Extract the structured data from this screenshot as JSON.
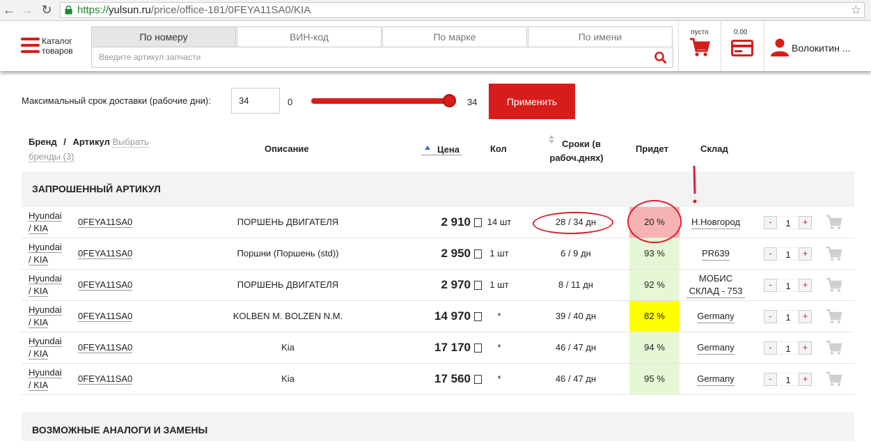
{
  "browser": {
    "url_secure": "https://",
    "url_domain": "yulsun.ru",
    "url_path": "/price/office-181/0FEYA11SA0/KIA"
  },
  "header": {
    "catalog_label": "Каталог товаров",
    "tabs": [
      {
        "label": "По номеру",
        "active": true
      },
      {
        "label": "ВИН-код",
        "active": false
      },
      {
        "label": "По марке",
        "active": false
      },
      {
        "label": "По имени",
        "active": false
      }
    ],
    "search_placeholder": "Введите артикул запчасти",
    "cart_label": "пусто",
    "balance": "0.00",
    "user_name": "Волокитин ..."
  },
  "filter": {
    "label": "Максимальный срок доставки (рабочие дни):",
    "input_value": "34",
    "range_min": "0",
    "range_max": "34",
    "apply_label": "Применить"
  },
  "table": {
    "headers": {
      "brand": "Бренд",
      "sep": "/",
      "article": "Артикул",
      "choose_brands_1": "Выбрать",
      "choose_brands_2": "бренды (3)",
      "description": "Описание",
      "price": "Цена",
      "qty": "Кол",
      "terms_1": "Сроки (в",
      "terms_2": "рабоч.днях)",
      "probability": "Придет",
      "warehouse": "Склад"
    },
    "section_requested": "ЗАПРОШЕННЫЙ АРТИКУЛ",
    "section_analogs": "ВОЗМОЖНЫЕ АНАЛОГИ И ЗАМЕНЫ",
    "rows": [
      {
        "brand1": "Hyundai",
        "brand2": "/ KIA",
        "article": "0FEYA11SA0",
        "description": "ПОРШЕНЬ ДВИГАТЕЛЯ",
        "price": "2 910",
        "qty": "14 шт",
        "terms": "28 / 34 дн",
        "probability": "20 %",
        "prob_color": "#f5b3b3",
        "warehouse": "Н.Новгород",
        "count": "1"
      },
      {
        "brand1": "Hyundai",
        "brand2": "/ KIA",
        "article": "0FEYA11SA0",
        "description": "Поршни (Поршень (std))",
        "price": "2 950",
        "qty": "1 шт",
        "terms": "6 / 9 дн",
        "probability": "93 %",
        "prob_color": "#e6f7d6",
        "warehouse": "PR639",
        "count": "1"
      },
      {
        "brand1": "Hyundai",
        "brand2": "/ KIA",
        "article": "0FEYA11SA0",
        "description": "ПОРШЕНЬ ДВИГАТЕЛЯ",
        "price": "2 970",
        "qty": "1 шт",
        "terms": "8 / 11 дн",
        "probability": "92 %",
        "prob_color": "#e6f7d6",
        "warehouse": "МОБИС СКЛАД - 753",
        "count": "1"
      },
      {
        "brand1": "Hyundai",
        "brand2": "/ KIA",
        "article": "0FEYA11SA0",
        "description": "KOLBEN M. BOLZEN N.M.",
        "price": "14 970",
        "qty": "*",
        "terms": "39 / 40 дн",
        "probability": "82 %",
        "prob_color": "#ffff00",
        "warehouse": "Germany",
        "count": "1"
      },
      {
        "brand1": "Hyundai",
        "brand2": "/ KIA",
        "article": "0FEYA11SA0",
        "description": "Kia",
        "price": "17 170",
        "qty": "*",
        "terms": "46 / 47 дн",
        "probability": "94 %",
        "prob_color": "#e6f7d6",
        "warehouse": "Germany",
        "count": "1"
      },
      {
        "brand1": "Hyundai",
        "brand2": "/ KIA",
        "article": "0FEYA11SA0",
        "description": "Kia",
        "price": "17 560",
        "qty": "*",
        "terms": "46 / 47 дн",
        "probability": "95 %",
        "prob_color": "#e6f7d6",
        "warehouse": "Germany",
        "count": "1"
      }
    ]
  },
  "colors": {
    "accent": "#d71c1c",
    "annotation": "#e01a2a"
  }
}
